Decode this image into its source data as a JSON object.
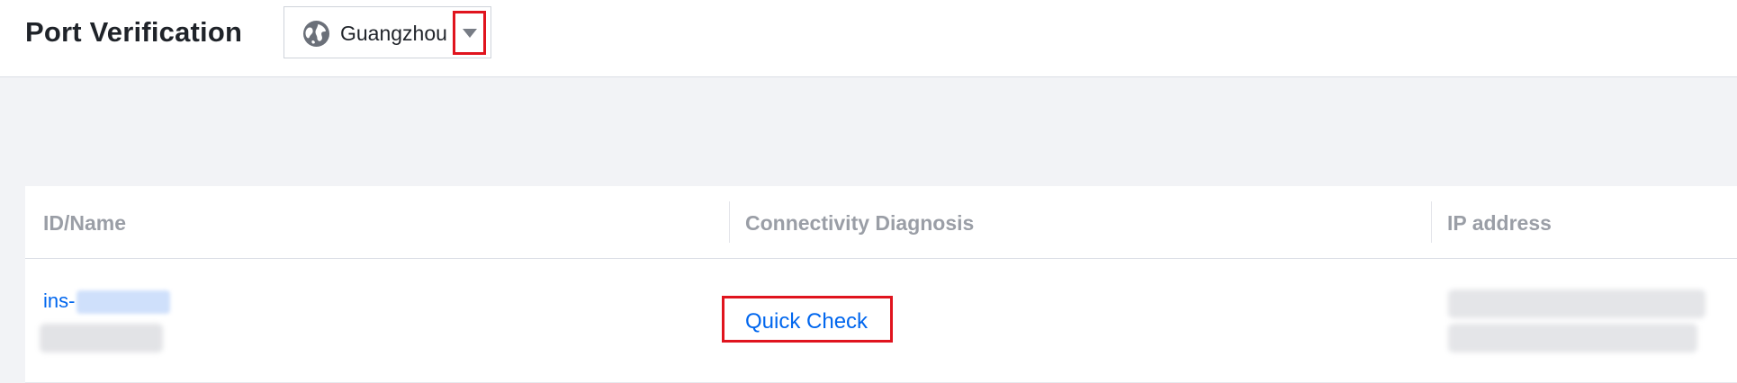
{
  "header": {
    "title": "Port Verification",
    "region": {
      "icon": "globe-icon",
      "label": "Guangzhou",
      "dropdown_icon": "chevron-down-icon"
    }
  },
  "table": {
    "columns": [
      "ID/Name",
      "Connectivity Diagnosis",
      "IP address"
    ],
    "rows": [
      {
        "id_prefix": "ins-",
        "action": "Quick Check"
      }
    ]
  },
  "colors": {
    "link": "#0066ee",
    "highlight": "#e0141e",
    "header_text": "#9a9ea6",
    "background": "#f2f3f6"
  }
}
